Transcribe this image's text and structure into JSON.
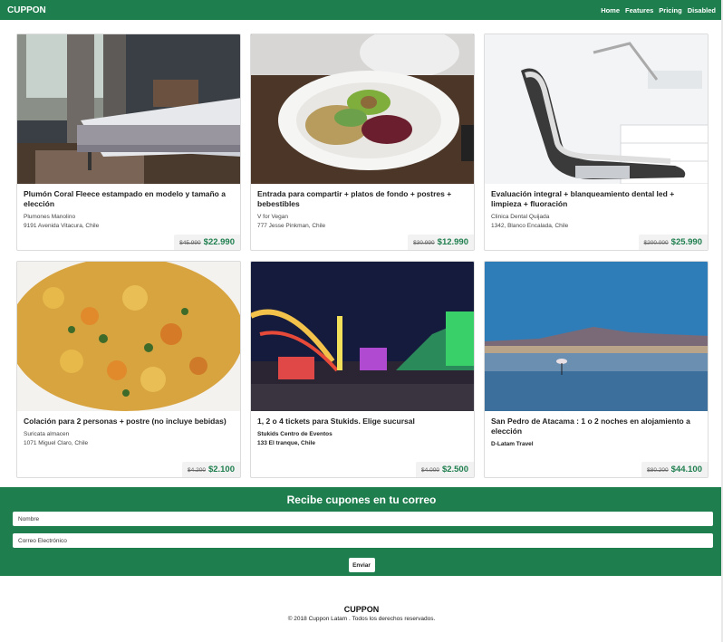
{
  "navbar": {
    "brand": "CUPPON",
    "links": [
      "Home",
      "Features",
      "Pricing",
      "Disabled"
    ]
  },
  "cards": [
    {
      "title": "Plumón Coral Fleece estampado en modelo y tamaño a elección",
      "merchant": "Plumones Manolino",
      "address": "9191 Avenida Vitacura, Chile",
      "old_price": "$45.990",
      "new_price": "$22.990",
      "image": "bedroom-photo"
    },
    {
      "title": "Entrada para compartir + platos de fondo + postres + bebestibles",
      "merchant": "V for Vegan",
      "address": "777 Jesse Pinkman, Chile",
      "old_price": "$30.990",
      "new_price": "$12.990",
      "image": "vegan-dish-photo"
    },
    {
      "title": "Evaluación integral + blanqueamiento dental led + limpieza + fluoración",
      "merchant": "Clinica Dental Quijada",
      "address": "1342, Blanco Encalada, Chile",
      "old_price": "$200.000",
      "new_price": "$25.990",
      "image": "dental-chair-photo"
    },
    {
      "title": "Colación para 2 personas + postre (no incluye bebidas)",
      "merchant": "Suricata almacen",
      "address": "1071 Miguel Claro, Chile",
      "old_price": "$4.200",
      "new_price": "$2.100",
      "image": "rice-dish-photo"
    },
    {
      "title": "1, 2 o 4 tickets para Stukids. Elige sucursal",
      "merchant": "Stukids Centro de Eventos",
      "address": "133 El tranque, Chile",
      "old_price": "$4.000",
      "new_price": "$2.500",
      "image": "fairground-photo"
    },
    {
      "title": "San Pedro de Atacama : 1 o 2 noches en alojamiento a elección",
      "merchant": "D-Latam Travel",
      "address": "",
      "old_price": "$80.200",
      "new_price": "$44.100",
      "image": "atacama-lake-photo"
    }
  ],
  "newsletter": {
    "title": "Recibe cupones en tu correo",
    "name_placeholder": "Nombre",
    "email_placeholder": "Correo Electrónico",
    "submit_label": "Enviar"
  },
  "footer": {
    "brand": "CUPPON",
    "copyright": "© 2018 Cuppon Latam . Todos los derechos reservados."
  },
  "colors": {
    "brand_green": "#1e7e4e",
    "price_green": "#1e7e4e"
  }
}
